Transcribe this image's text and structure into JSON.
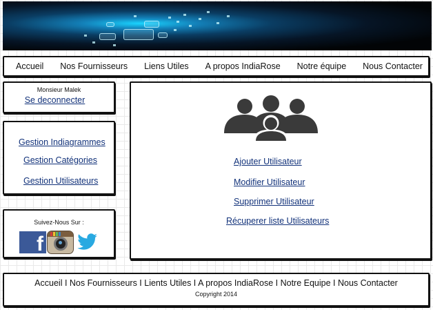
{
  "nav": {
    "items": [
      "Accueil",
      "Nos Fournisseurs",
      "Liens Utiles",
      "A propos IndiaRose",
      "Notre équipe",
      "Nous Contacter"
    ]
  },
  "user": {
    "name": "Monsieur Malek",
    "logout_label": "Se deconnecter"
  },
  "manage": {
    "items": [
      "Gestion Indiagrammes",
      "Gestion Catégories",
      "Gestion Utilisateurs"
    ]
  },
  "social": {
    "title": "Suivez-Nous Sur :",
    "icons": [
      "facebook-icon",
      "instagram-icon",
      "twitter-icon"
    ]
  },
  "main": {
    "icon": "users-group-icon",
    "actions": [
      "Ajouter Utilisateur",
      "Modifier Utilisateur",
      "Supprimer Utilisateur",
      "Récuperer liste Utilisateurs"
    ]
  },
  "footer": {
    "links": "Accueil I Nos Fournisseurs I Lients Utiles I A propos IndiaRose I Notre Equipe I Nous Contacter",
    "copyright": "Copyright 2014"
  },
  "colors": {
    "link": "#12327a",
    "border": "#111111",
    "icon": "#3a3a3a",
    "facebook": "#3b5998",
    "twitter": "#29a9e1"
  }
}
